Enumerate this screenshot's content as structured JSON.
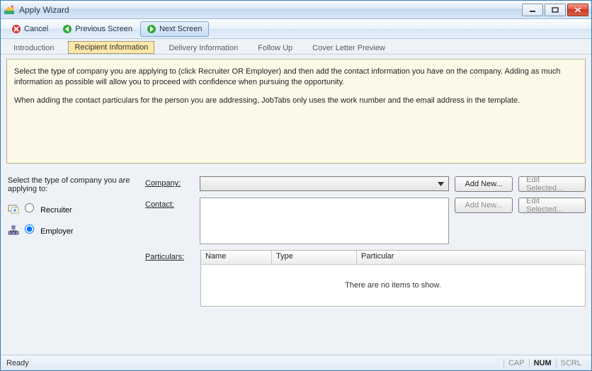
{
  "window": {
    "title": "Apply Wizard"
  },
  "toolbar": {
    "cancel": "Cancel",
    "prev": "Previous Screen",
    "next": "Next Screen"
  },
  "tabs": {
    "intro": "Introduction",
    "recipient": "Recipient Information",
    "delivery": "Delivery Information",
    "followup": "Follow Up",
    "cover": "Cover Letter Preview"
  },
  "info": {
    "p1": "Select the type of company you are applying to (click Recruiter OR Employer) and then add the contact information you have on the company.  Adding as much information as possible will allow you to proceed with confidence when pursuing the opportunity.",
    "p2": "When adding the contact particulars for the person you are addressing, JobTabs only uses the work number and the email address in the template."
  },
  "form": {
    "select_type_prompt": "Select the type of company you are applying to:",
    "recruiter_label": "Recruiter",
    "employer_label": "Employer",
    "company_label": "Company:",
    "contact_label": "Contact:",
    "particulars_label": "Particulars:",
    "add_new": "Add New...",
    "edit_selected": "Edit Selected...",
    "company_value": "",
    "contact_value": ""
  },
  "grid": {
    "columns": {
      "name": "Name",
      "type": "Type",
      "particular": "Particular"
    },
    "empty": "There are no items to show."
  },
  "status": {
    "ready": "Ready",
    "cap": "CAP",
    "num": "NUM",
    "scrl": "SCRL"
  }
}
